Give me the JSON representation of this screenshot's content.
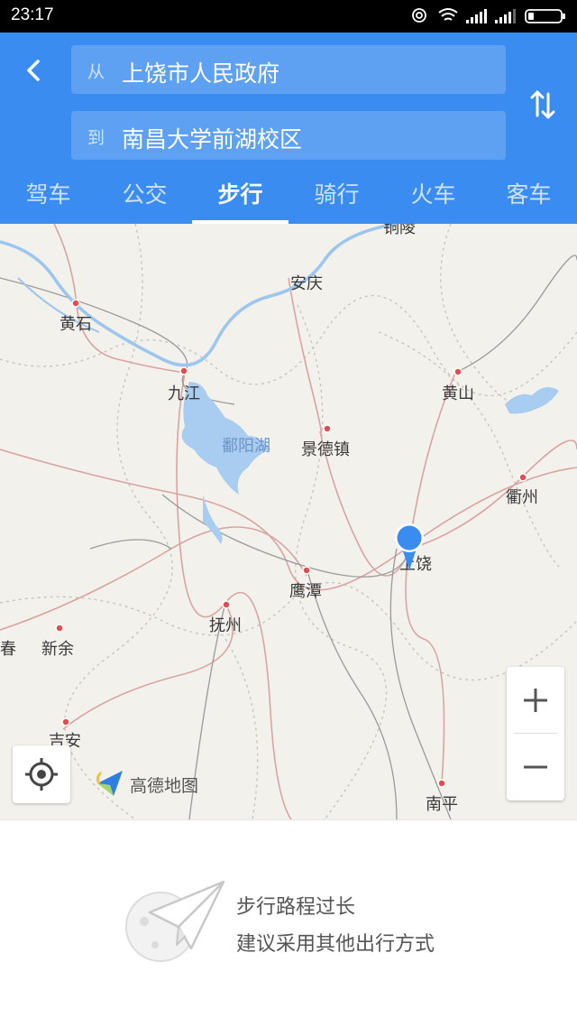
{
  "status_bar": {
    "time": "23:17"
  },
  "route": {
    "from_prefix": "从",
    "from_value": "上饶市人民政府",
    "to_prefix": "到",
    "to_value": "南昌大学前湖校区"
  },
  "tabs": [
    {
      "label": "驾车",
      "active": false
    },
    {
      "label": "公交",
      "active": false
    },
    {
      "label": "步行",
      "active": true
    },
    {
      "label": "骑行",
      "active": false
    },
    {
      "label": "火车",
      "active": false
    },
    {
      "label": "客车",
      "active": false
    }
  ],
  "map": {
    "cities": {
      "tongling": "铜陵",
      "anqing": "安庆",
      "huangshi": "黄石",
      "jiujiang": "九江",
      "huangshan": "黄山",
      "jingdezhen": "景德镇",
      "quzhou": "衢州",
      "shangrao": "上饶",
      "yingtan": "鹰潭",
      "fuzhou": "抚州",
      "chun": "春",
      "xinyu": "新余",
      "jian": "吉安",
      "nanping": "南平"
    },
    "lake": "鄱阳湖",
    "brand": "高德地图",
    "marker_color": "#3b8cf0"
  },
  "notice": {
    "line1": "步行路程过长",
    "line2": "建议采用其他出行方式"
  },
  "colors": {
    "header": "#3b8cf0",
    "water": "#a8cdf0"
  }
}
